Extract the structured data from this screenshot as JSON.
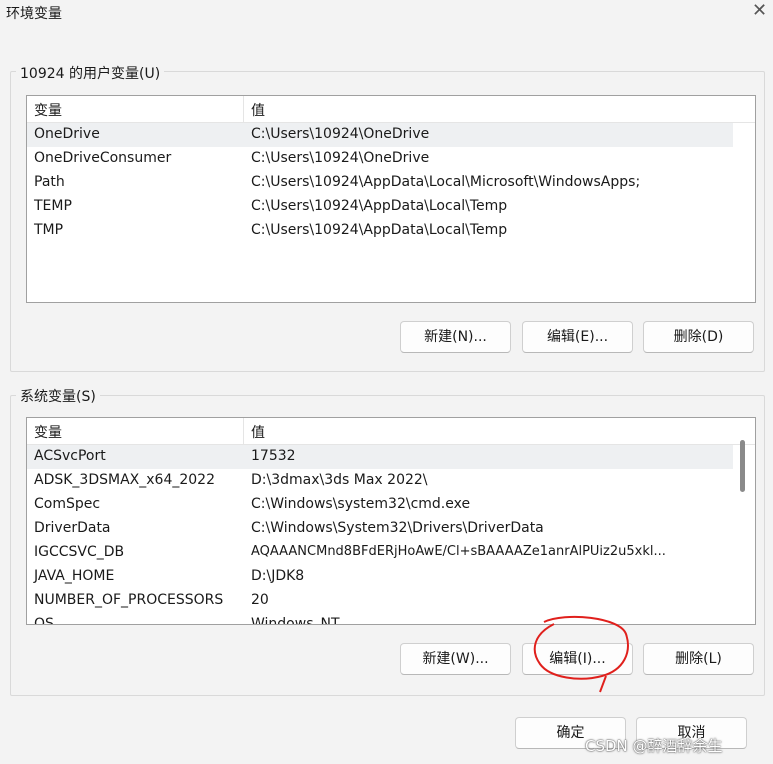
{
  "window": {
    "title": "环境变量",
    "close_glyph": "✕"
  },
  "user_vars": {
    "label": "10924 的用户变量(U)",
    "col_name": "变量",
    "col_value": "值",
    "rows": [
      {
        "name": "OneDrive",
        "value": "C:\\Users\\10924\\OneDrive"
      },
      {
        "name": "OneDriveConsumer",
        "value": "C:\\Users\\10924\\OneDrive"
      },
      {
        "name": "Path",
        "value": "C:\\Users\\10924\\AppData\\Local\\Microsoft\\WindowsApps;"
      },
      {
        "name": "TEMP",
        "value": "C:\\Users\\10924\\AppData\\Local\\Temp"
      },
      {
        "name": "TMP",
        "value": "C:\\Users\\10924\\AppData\\Local\\Temp"
      }
    ],
    "new_label": "新建(N)...",
    "edit_label": "编辑(E)...",
    "delete_label": "删除(D)"
  },
  "system_vars": {
    "label": "系统变量(S)",
    "col_name": "变量",
    "col_value": "值",
    "rows": [
      {
        "name": "ACSvcPort",
        "value": "17532"
      },
      {
        "name": "ADSK_3DSMAX_x64_2022",
        "value": "D:\\3dmax\\3ds Max 2022\\"
      },
      {
        "name": "ComSpec",
        "value": "C:\\Windows\\system32\\cmd.exe"
      },
      {
        "name": "DriverData",
        "value": "C:\\Windows\\System32\\Drivers\\DriverData"
      },
      {
        "name": "IGCCSVC_DB",
        "value": "AQAAANCMnd8BFdERjHoAwE/Cl+sBAAAAZe1anrAlPUiz2u5xkl..."
      },
      {
        "name": "JAVA_HOME",
        "value": "D:\\JDK8"
      },
      {
        "name": "NUMBER_OF_PROCESSORS",
        "value": "20"
      },
      {
        "name": "OS",
        "value": "Windows_NT"
      }
    ],
    "new_label": "新建(W)...",
    "edit_label": "编辑(I)...",
    "delete_label": "删除(L)"
  },
  "footer": {
    "ok_label": "确定",
    "cancel_label": "取消"
  },
  "watermark": "CSDN @醉酒辞余生",
  "colors": {
    "selected_row": "#eef0f2",
    "annotation": "#e0201c"
  }
}
